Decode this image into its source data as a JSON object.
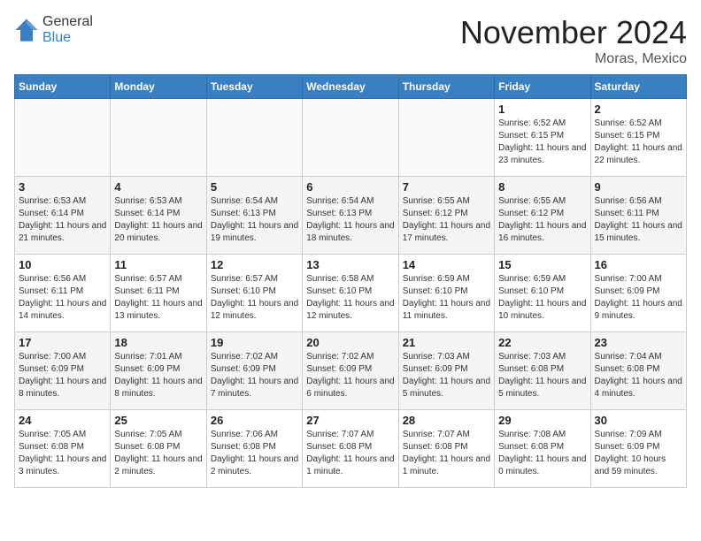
{
  "header": {
    "logo_general": "General",
    "logo_blue": "Blue",
    "month_title": "November 2024",
    "location": "Moras, Mexico"
  },
  "weekdays": [
    "Sunday",
    "Monday",
    "Tuesday",
    "Wednesday",
    "Thursday",
    "Friday",
    "Saturday"
  ],
  "weeks": [
    [
      {
        "day": "",
        "info": ""
      },
      {
        "day": "",
        "info": ""
      },
      {
        "day": "",
        "info": ""
      },
      {
        "day": "",
        "info": ""
      },
      {
        "day": "",
        "info": ""
      },
      {
        "day": "1",
        "info": "Sunrise: 6:52 AM\nSunset: 6:15 PM\nDaylight: 11 hours and 23 minutes."
      },
      {
        "day": "2",
        "info": "Sunrise: 6:52 AM\nSunset: 6:15 PM\nDaylight: 11 hours and 22 minutes."
      }
    ],
    [
      {
        "day": "3",
        "info": "Sunrise: 6:53 AM\nSunset: 6:14 PM\nDaylight: 11 hours and 21 minutes."
      },
      {
        "day": "4",
        "info": "Sunrise: 6:53 AM\nSunset: 6:14 PM\nDaylight: 11 hours and 20 minutes."
      },
      {
        "day": "5",
        "info": "Sunrise: 6:54 AM\nSunset: 6:13 PM\nDaylight: 11 hours and 19 minutes."
      },
      {
        "day": "6",
        "info": "Sunrise: 6:54 AM\nSunset: 6:13 PM\nDaylight: 11 hours and 18 minutes."
      },
      {
        "day": "7",
        "info": "Sunrise: 6:55 AM\nSunset: 6:12 PM\nDaylight: 11 hours and 17 minutes."
      },
      {
        "day": "8",
        "info": "Sunrise: 6:55 AM\nSunset: 6:12 PM\nDaylight: 11 hours and 16 minutes."
      },
      {
        "day": "9",
        "info": "Sunrise: 6:56 AM\nSunset: 6:11 PM\nDaylight: 11 hours and 15 minutes."
      }
    ],
    [
      {
        "day": "10",
        "info": "Sunrise: 6:56 AM\nSunset: 6:11 PM\nDaylight: 11 hours and 14 minutes."
      },
      {
        "day": "11",
        "info": "Sunrise: 6:57 AM\nSunset: 6:11 PM\nDaylight: 11 hours and 13 minutes."
      },
      {
        "day": "12",
        "info": "Sunrise: 6:57 AM\nSunset: 6:10 PM\nDaylight: 11 hours and 12 minutes."
      },
      {
        "day": "13",
        "info": "Sunrise: 6:58 AM\nSunset: 6:10 PM\nDaylight: 11 hours and 12 minutes."
      },
      {
        "day": "14",
        "info": "Sunrise: 6:59 AM\nSunset: 6:10 PM\nDaylight: 11 hours and 11 minutes."
      },
      {
        "day": "15",
        "info": "Sunrise: 6:59 AM\nSunset: 6:10 PM\nDaylight: 11 hours and 10 minutes."
      },
      {
        "day": "16",
        "info": "Sunrise: 7:00 AM\nSunset: 6:09 PM\nDaylight: 11 hours and 9 minutes."
      }
    ],
    [
      {
        "day": "17",
        "info": "Sunrise: 7:00 AM\nSunset: 6:09 PM\nDaylight: 11 hours and 8 minutes."
      },
      {
        "day": "18",
        "info": "Sunrise: 7:01 AM\nSunset: 6:09 PM\nDaylight: 11 hours and 8 minutes."
      },
      {
        "day": "19",
        "info": "Sunrise: 7:02 AM\nSunset: 6:09 PM\nDaylight: 11 hours and 7 minutes."
      },
      {
        "day": "20",
        "info": "Sunrise: 7:02 AM\nSunset: 6:09 PM\nDaylight: 11 hours and 6 minutes."
      },
      {
        "day": "21",
        "info": "Sunrise: 7:03 AM\nSunset: 6:09 PM\nDaylight: 11 hours and 5 minutes."
      },
      {
        "day": "22",
        "info": "Sunrise: 7:03 AM\nSunset: 6:08 PM\nDaylight: 11 hours and 5 minutes."
      },
      {
        "day": "23",
        "info": "Sunrise: 7:04 AM\nSunset: 6:08 PM\nDaylight: 11 hours and 4 minutes."
      }
    ],
    [
      {
        "day": "24",
        "info": "Sunrise: 7:05 AM\nSunset: 6:08 PM\nDaylight: 11 hours and 3 minutes."
      },
      {
        "day": "25",
        "info": "Sunrise: 7:05 AM\nSunset: 6:08 PM\nDaylight: 11 hours and 2 minutes."
      },
      {
        "day": "26",
        "info": "Sunrise: 7:06 AM\nSunset: 6:08 PM\nDaylight: 11 hours and 2 minutes."
      },
      {
        "day": "27",
        "info": "Sunrise: 7:07 AM\nSunset: 6:08 PM\nDaylight: 11 hours and 1 minute."
      },
      {
        "day": "28",
        "info": "Sunrise: 7:07 AM\nSunset: 6:08 PM\nDaylight: 11 hours and 1 minute."
      },
      {
        "day": "29",
        "info": "Sunrise: 7:08 AM\nSunset: 6:08 PM\nDaylight: 11 hours and 0 minutes."
      },
      {
        "day": "30",
        "info": "Sunrise: 7:09 AM\nSunset: 6:09 PM\nDaylight: 10 hours and 59 minutes."
      }
    ]
  ]
}
